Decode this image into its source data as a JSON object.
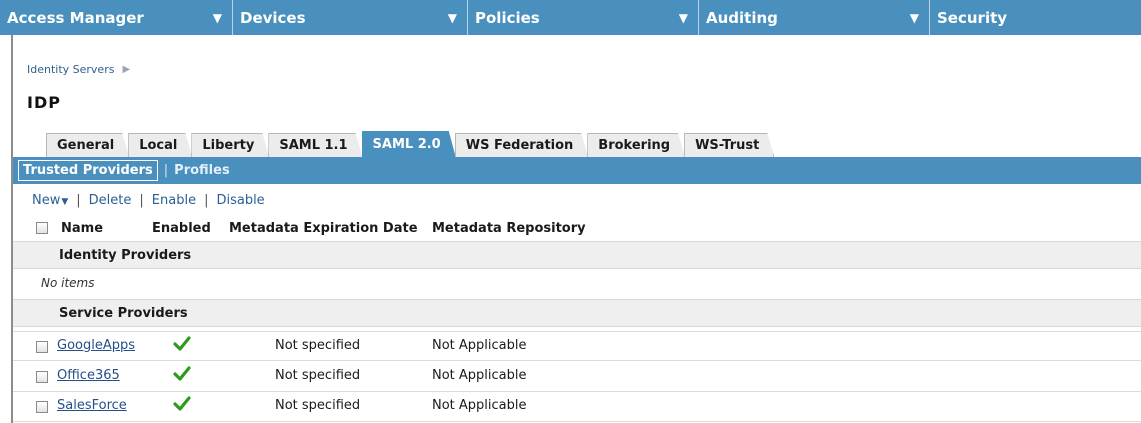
{
  "nav": {
    "items": [
      {
        "label": "Access Manager",
        "arrow": "▼"
      },
      {
        "label": "Devices",
        "arrow": "▼"
      },
      {
        "label": "Policies",
        "arrow": "▼"
      },
      {
        "label": "Auditing",
        "arrow": "▼"
      },
      {
        "label": "Security"
      }
    ]
  },
  "breadcrumb": {
    "item": "Identity Servers",
    "arrow": "▶"
  },
  "page_title": "IDP",
  "tabs": [
    {
      "label": "General"
    },
    {
      "label": "Local"
    },
    {
      "label": "Liberty"
    },
    {
      "label": "SAML 1.1"
    },
    {
      "label": "SAML 2.0",
      "active": true
    },
    {
      "label": "WS Federation"
    },
    {
      "label": "Brokering"
    },
    {
      "label": "WS-Trust"
    }
  ],
  "subtabs": {
    "active": "Trusted Providers",
    "separator": "|",
    "other": "Profiles"
  },
  "actions": {
    "new": "New",
    "delete": "Delete",
    "enable": "Enable",
    "disable": "Disable",
    "separator": "|"
  },
  "table": {
    "columns": {
      "name": "Name",
      "enabled": "Enabled",
      "expiration": "Metadata Expiration Date",
      "repository": "Metadata Repository"
    },
    "sections": {
      "identity_providers": {
        "title": "Identity Providers",
        "empty_text": "No items"
      },
      "service_providers": {
        "title": "Service Providers",
        "rows": [
          {
            "name": "GoogleApps",
            "enabled_icon": "checkmark-icon",
            "expiration": "Not specified",
            "repository": "Not Applicable"
          },
          {
            "name": "Office365",
            "enabled_icon": "checkmark-icon",
            "expiration": "Not specified",
            "repository": "Not Applicable"
          },
          {
            "name": "SalesForce",
            "enabled_icon": "checkmark-icon",
            "expiration": "Not specified",
            "repository": "Not Applicable"
          }
        ]
      }
    }
  },
  "colors": {
    "nav_blue": "#4a90bf",
    "check_green": "#2e9a1f",
    "link_blue": "#254f8a"
  }
}
